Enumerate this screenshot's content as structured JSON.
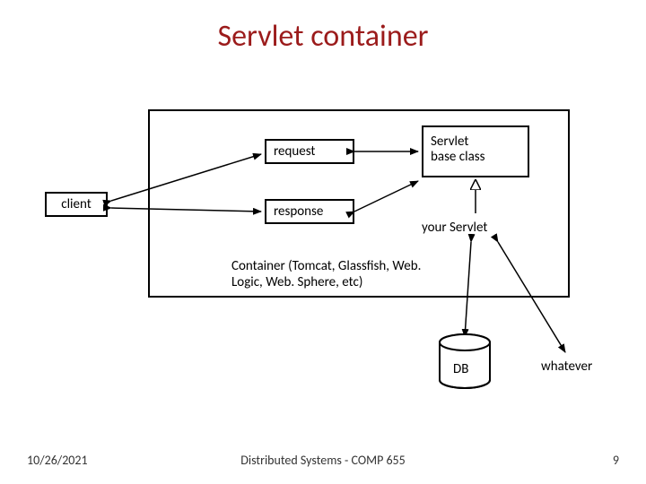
{
  "title": "Servlet container",
  "client": "client",
  "request": "request",
  "response": "response",
  "servlet_base_line1": "Servlet",
  "servlet_base_line2": "base class",
  "your_servlet": "your Servlet",
  "container_label": "Container (Tomcat, Glassfish, Web. Logic, Web. Sphere, etc)",
  "db": "DB",
  "whatever": "whatever",
  "footer": {
    "date": "10/26/2021",
    "center": "Distributed Systems - COMP 655",
    "page": "9"
  }
}
